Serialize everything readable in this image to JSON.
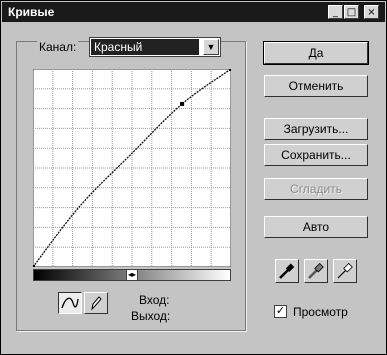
{
  "window": {
    "title": "Кривые",
    "controls": {
      "minimize": "_",
      "maximize": "□",
      "close": "×"
    }
  },
  "channel": {
    "label": "Канал:",
    "selected": "Красный",
    "dropdown_icon": "▼"
  },
  "curve": {
    "points_0_255": [
      [
        0,
        0
      ],
      [
        60,
        78
      ],
      [
        128,
        147
      ],
      [
        192,
        210
      ],
      [
        255,
        255
      ]
    ]
  },
  "gradient_handle_icon": "◂▸",
  "readout": {
    "input_label": "Вход:",
    "output_label": "Выход:"
  },
  "buttons": {
    "ok": "Да",
    "cancel": "Отменить",
    "load": "Загрузить...",
    "save": "Сохранить...",
    "smooth": "Сгладить",
    "auto": "Авто"
  },
  "preview": {
    "label": "Просмотр",
    "checked": true,
    "check_mark": "✓"
  },
  "tools": {
    "curve_tool": "curve-icon",
    "pencil_tool": "pencil-icon"
  },
  "eyedroppers": [
    "eyedropper-black-icon",
    "eyedropper-gray-icon",
    "eyedropper-white-icon"
  ]
}
